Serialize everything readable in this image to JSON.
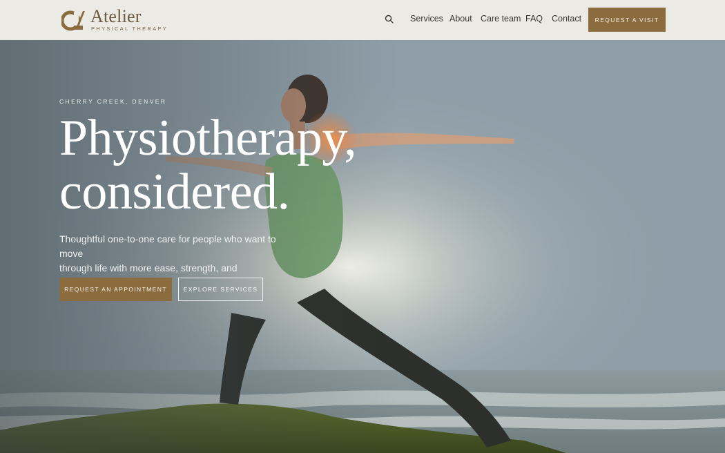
{
  "brand": {
    "name": "Atelier",
    "tagline": "PHYSICAL THERAPY",
    "accent_color": "#8b6c3f"
  },
  "nav": {
    "search_icon": "search-icon",
    "items": [
      "Services",
      "About",
      "Care team",
      "FAQ",
      "Contact"
    ],
    "cta_label": "REQUEST A VISIT"
  },
  "hero": {
    "eyebrow": "CHERRY CREEK, DENVER",
    "headline_line1": "Physiotherapy,",
    "headline_line2": "considered.",
    "lede_line1": "Thoughtful one-to-one care for people who want to move",
    "lede_line2": "through life with more ease, strength, and confidence.",
    "primary_cta": "REQUEST AN APPOINTMENT",
    "secondary_cta": "EXPLORE SERVICES",
    "background": "photo of woman in warrior yoga pose on rock by the ocean at sunrise"
  }
}
